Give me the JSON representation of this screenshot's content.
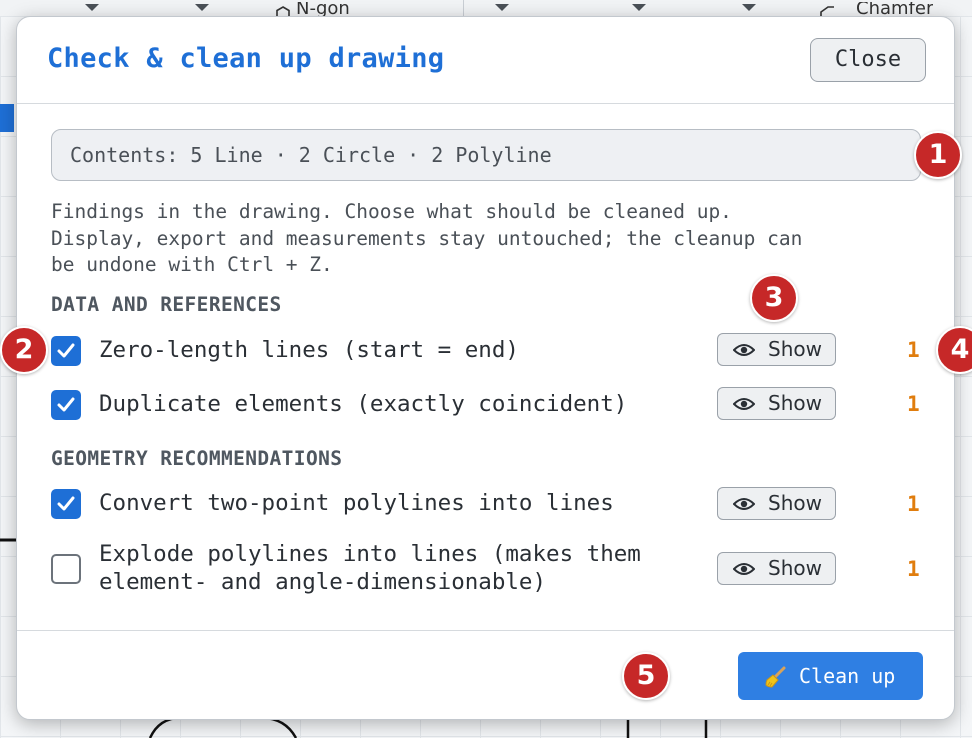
{
  "background_toolbar": {
    "ngon_label": "N-gon",
    "chamfer_label": "Chamfer"
  },
  "dialog": {
    "title": "Check & clean up drawing",
    "close_label": "Close",
    "contents_summary": "Contents: 5 Line · 2 Circle · 2 Polyline",
    "description": "Findings in the drawing. Choose what should be cleaned up.\nDisplay, export and measurements stay untouched; the cleanup can\nbe undone with Ctrl + Z.",
    "sections": [
      {
        "heading": "DATA AND REFERENCES",
        "items": [
          {
            "label": "Zero-length lines (start = end)",
            "checked": true,
            "show_label": "Show",
            "count": "1"
          },
          {
            "label": "Duplicate elements (exactly coincident)",
            "checked": true,
            "show_label": "Show",
            "count": "1"
          }
        ]
      },
      {
        "heading": "GEOMETRY RECOMMENDATIONS",
        "items": [
          {
            "label": "Convert two-point polylines into lines",
            "checked": true,
            "show_label": "Show",
            "count": "1"
          },
          {
            "label": "Explode polylines into lines (makes them\nelement- and angle-dimensionable)",
            "checked": false,
            "show_label": "Show",
            "count": "1"
          }
        ]
      }
    ],
    "cleanup_label": "Clean up",
    "icons": {
      "show": "eye-icon",
      "cleanup": "broom-icon",
      "check": "checkmark-icon"
    }
  },
  "markers": [
    "1",
    "2",
    "3",
    "4",
    "5"
  ],
  "colors": {
    "accent": "#1e6fd6",
    "count": "#e07d0e",
    "marker": "#c62828",
    "primary_button": "#2f7fe3"
  }
}
